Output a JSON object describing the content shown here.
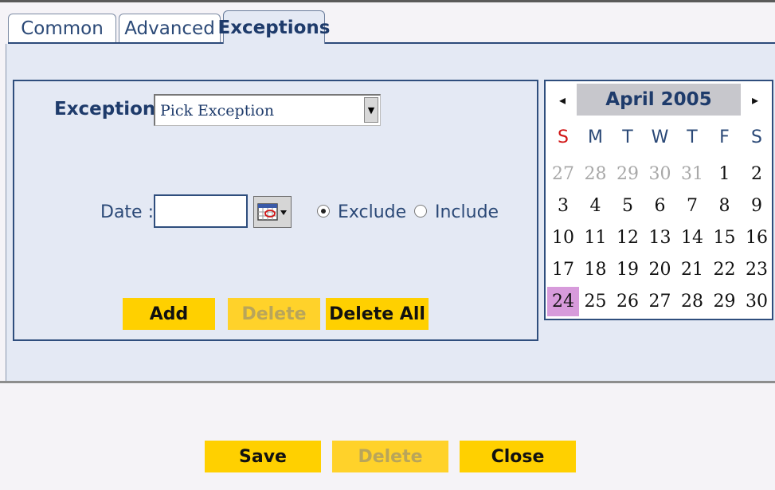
{
  "tabs": [
    {
      "label": "Common",
      "active": false
    },
    {
      "label": "Advanced",
      "active": false
    },
    {
      "label": "Exceptions",
      "active": true
    }
  ],
  "form": {
    "exceptions_label": "Exceptions :",
    "exceptions_value": "Pick Exception",
    "date_label": "Date :",
    "date_value": "",
    "exclude_label": "Exclude",
    "include_label": "Include",
    "selected_mode": "Exclude",
    "add_label": "Add",
    "delete_label": "Delete",
    "delete_all_label": "Delete All"
  },
  "calendar": {
    "title": "April 2005",
    "prev": "◂",
    "next": "▸",
    "weekdays": [
      "S",
      "M",
      "T",
      "W",
      "T",
      "F",
      "S"
    ],
    "weeks": [
      [
        {
          "d": "27",
          "o": true
        },
        {
          "d": "28",
          "o": true
        },
        {
          "d": "29",
          "o": true
        },
        {
          "d": "30",
          "o": true
        },
        {
          "d": "31",
          "o": true
        },
        {
          "d": "1"
        },
        {
          "d": "2"
        }
      ],
      [
        {
          "d": "3"
        },
        {
          "d": "4"
        },
        {
          "d": "5"
        },
        {
          "d": "6"
        },
        {
          "d": "7"
        },
        {
          "d": "8"
        },
        {
          "d": "9"
        }
      ],
      [
        {
          "d": "10"
        },
        {
          "d": "11"
        },
        {
          "d": "12"
        },
        {
          "d": "13"
        },
        {
          "d": "14"
        },
        {
          "d": "15"
        },
        {
          "d": "16"
        }
      ],
      [
        {
          "d": "17"
        },
        {
          "d": "18"
        },
        {
          "d": "19"
        },
        {
          "d": "20"
        },
        {
          "d": "21"
        },
        {
          "d": "22"
        },
        {
          "d": "23"
        }
      ],
      [
        {
          "d": "24",
          "today": true
        },
        {
          "d": "25"
        },
        {
          "d": "26"
        },
        {
          "d": "27"
        },
        {
          "d": "28"
        },
        {
          "d": "29"
        },
        {
          "d": "30"
        }
      ]
    ]
  },
  "footer": {
    "save_label": "Save",
    "delete_label": "Delete",
    "close_label": "Close"
  },
  "colors": {
    "accent_button": "#ffd000",
    "panel_bg": "#e4e9f4",
    "title_text": "#1e3b6b",
    "today_highlight": "#d79bdb",
    "sunday_header": "#d11414"
  }
}
